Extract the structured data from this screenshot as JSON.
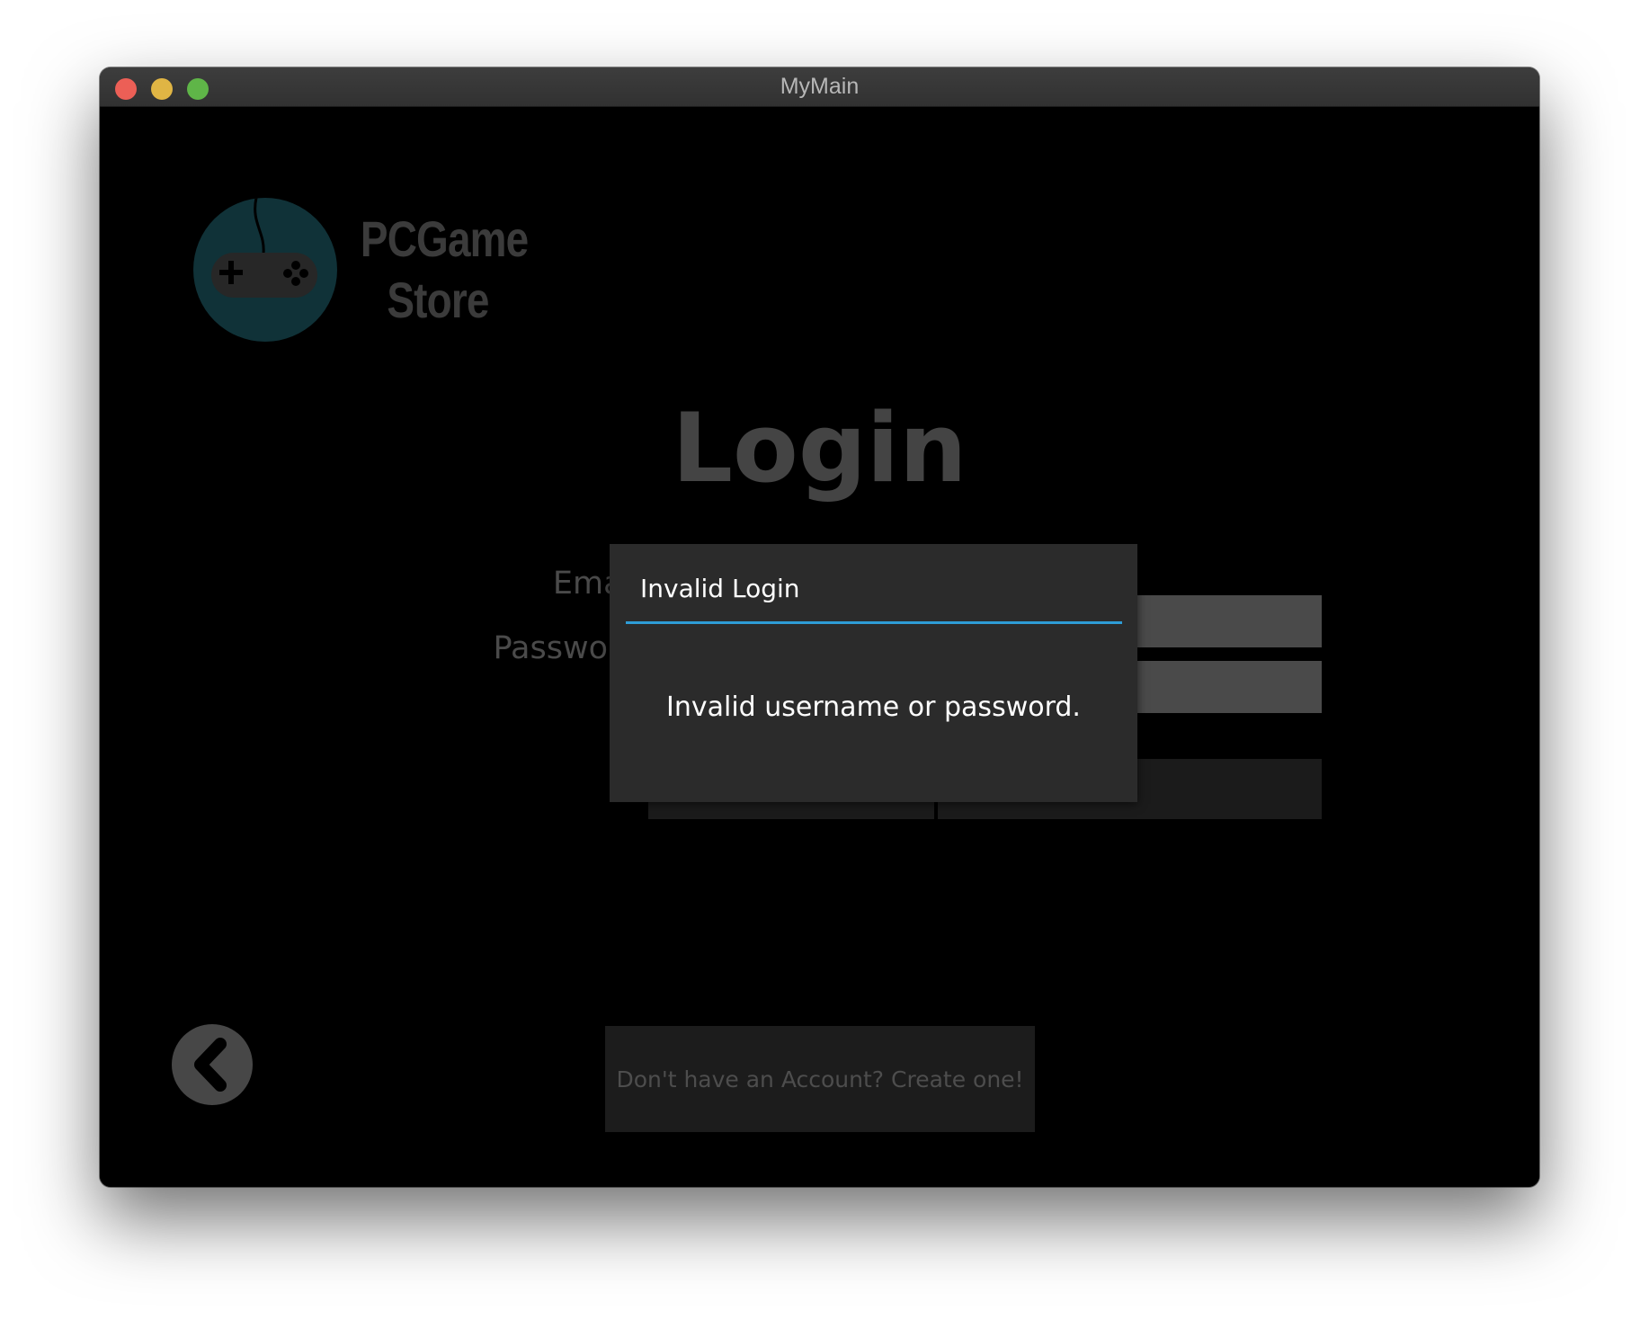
{
  "window": {
    "title": "MyMain"
  },
  "logo": {
    "line1": "PCGame",
    "line2": "Store",
    "color": "#103238"
  },
  "login": {
    "title": "Login",
    "email_label": "Email",
    "password_label": "Password"
  },
  "footer": {
    "create_account": "Don't have an Account? Create one!"
  },
  "dialog": {
    "title": "Invalid Login",
    "message": "Invalid username or password.",
    "accent": "#2e9cd6"
  },
  "icons": {
    "back": "chevron-left-icon",
    "logo": "gamepad-icon"
  }
}
